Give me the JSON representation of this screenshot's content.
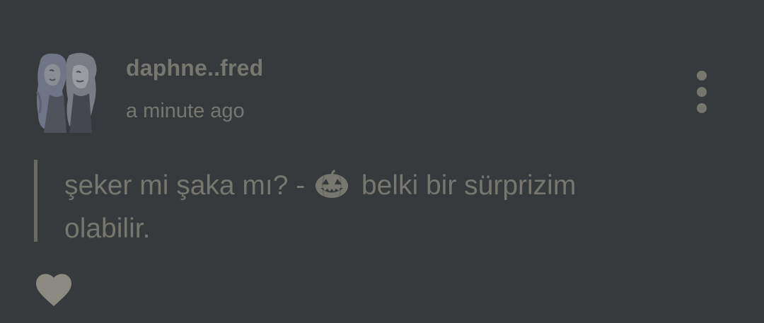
{
  "post": {
    "username": "daphne..fred",
    "timestamp": "a minute ago",
    "message": {
      "before_emoji": "şeker mi şaka mı? - ",
      "emoji_icon": "jack-o-lantern-icon",
      "after_emoji": " belki bir sürprizim olabilir."
    },
    "more_icon": "vertical-ellipsis-icon",
    "like_icon": "heart-icon"
  },
  "colors": {
    "background": "#363a3d",
    "text": "#77776f",
    "quote_bar": "#6b6b65",
    "heart": "#8c8a80"
  }
}
